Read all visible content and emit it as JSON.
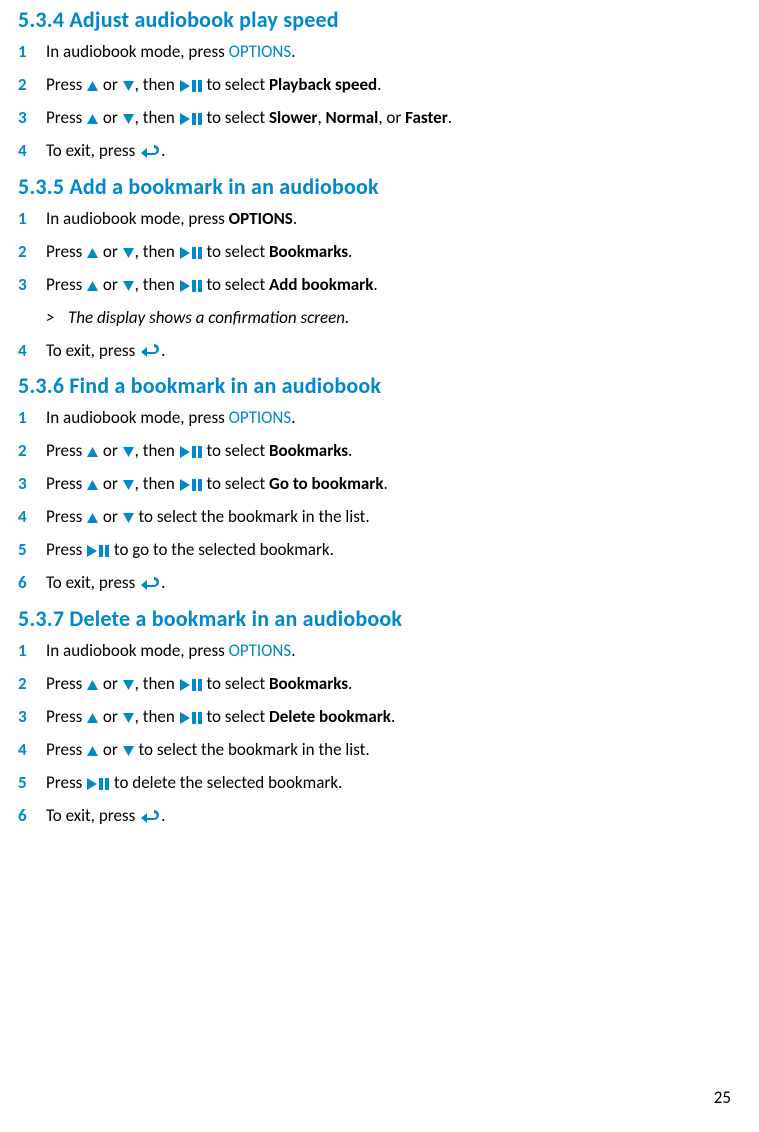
{
  "pageNumber": "25",
  "sections": [
    {
      "heading": "5.3.4 Adjust audiobook play speed",
      "steps": [
        {
          "num": "1",
          "parts": [
            {
              "t": "In audiobook mode, press "
            },
            {
              "t": "OPTIONS",
              "cls": "link-blue"
            },
            {
              "t": "."
            }
          ]
        },
        {
          "num": "2",
          "parts": [
            {
              "t": "Press "
            },
            {
              "icon": "up"
            },
            {
              "t": " or "
            },
            {
              "icon": "down"
            },
            {
              "t": ", then "
            },
            {
              "icon": "playpause"
            },
            {
              "t": " to select "
            },
            {
              "t": "Playback speed",
              "cls": "bold"
            },
            {
              "t": "."
            }
          ]
        },
        {
          "num": "3",
          "parts": [
            {
              "t": "Press "
            },
            {
              "icon": "up"
            },
            {
              "t": " or "
            },
            {
              "icon": "down"
            },
            {
              "t": ", then "
            },
            {
              "icon": "playpause"
            },
            {
              "t": " to select "
            },
            {
              "t": "Slower",
              "cls": "bold"
            },
            {
              "t": ", "
            },
            {
              "t": "Normal",
              "cls": "bold"
            },
            {
              "t": ", or "
            },
            {
              "t": "Faster",
              "cls": "bold"
            },
            {
              "t": "."
            }
          ]
        },
        {
          "num": "4",
          "parts": [
            {
              "t": "To exit, press "
            },
            {
              "icon": "back"
            },
            {
              "t": "."
            }
          ]
        }
      ]
    },
    {
      "heading": "5.3.5 Add a bookmark in an audiobook",
      "steps": [
        {
          "num": "1",
          "parts": [
            {
              "t": "In audiobook mode, press "
            },
            {
              "t": "OPTIONS",
              "cls": "bold"
            },
            {
              "t": "."
            }
          ]
        },
        {
          "num": "2",
          "parts": [
            {
              "t": "Press "
            },
            {
              "icon": "up"
            },
            {
              "t": " or "
            },
            {
              "icon": "down"
            },
            {
              "t": ", then "
            },
            {
              "icon": "playpause"
            },
            {
              "t": " to select "
            },
            {
              "t": "Bookmarks",
              "cls": "bold"
            },
            {
              "t": "."
            }
          ]
        },
        {
          "num": "3",
          "parts": [
            {
              "t": "Press "
            },
            {
              "icon": "up"
            },
            {
              "t": " or "
            },
            {
              "icon": "down"
            },
            {
              "t": ", then "
            },
            {
              "icon": "playpause"
            },
            {
              "t": " to select "
            },
            {
              "t": "Add bookmark",
              "cls": "bold"
            },
            {
              "t": "."
            }
          ]
        },
        {
          "sub": true,
          "marker": ">",
          "parts": [
            {
              "t": "The display shows a confirmation screen."
            }
          ]
        },
        {
          "num": "4",
          "parts": [
            {
              "t": "To exit, press "
            },
            {
              "icon": "back"
            },
            {
              "t": "."
            }
          ]
        }
      ]
    },
    {
      "heading": "5.3.6 Find a bookmark in an audiobook",
      "steps": [
        {
          "num": "1",
          "parts": [
            {
              "t": "In audiobook mode, press "
            },
            {
              "t": "OPTIONS",
              "cls": "link-blue"
            },
            {
              "t": "."
            }
          ]
        },
        {
          "num": "2",
          "parts": [
            {
              "t": "Press "
            },
            {
              "icon": "up"
            },
            {
              "t": " or "
            },
            {
              "icon": "down"
            },
            {
              "t": ", then "
            },
            {
              "icon": "playpause"
            },
            {
              "t": " to select "
            },
            {
              "t": "Bookmarks",
              "cls": "bold"
            },
            {
              "t": "."
            }
          ]
        },
        {
          "num": "3",
          "parts": [
            {
              "t": "Press "
            },
            {
              "icon": "up"
            },
            {
              "t": " or "
            },
            {
              "icon": "down"
            },
            {
              "t": ", then "
            },
            {
              "icon": "playpause"
            },
            {
              "t": " to select "
            },
            {
              "t": "Go to bookmark",
              "cls": "bold"
            },
            {
              "t": "."
            }
          ]
        },
        {
          "num": "4",
          "parts": [
            {
              "t": "Press "
            },
            {
              "icon": "up"
            },
            {
              "t": " or "
            },
            {
              "icon": "down"
            },
            {
              "t": " to select the bookmark in the list."
            }
          ]
        },
        {
          "num": "5",
          "parts": [
            {
              "t": "Press "
            },
            {
              "icon": "playpause"
            },
            {
              "t": " to go to the selected bookmark."
            }
          ]
        },
        {
          "num": "6",
          "parts": [
            {
              "t": "To exit, press "
            },
            {
              "icon": "back"
            },
            {
              "t": "."
            }
          ]
        }
      ]
    },
    {
      "heading": "5.3.7 Delete a bookmark in an audiobook",
      "steps": [
        {
          "num": "1",
          "parts": [
            {
              "t": "In audiobook mode, press "
            },
            {
              "t": "OPTIONS",
              "cls": "link-blue"
            },
            {
              "t": "."
            }
          ]
        },
        {
          "num": "2",
          "parts": [
            {
              "t": "Press "
            },
            {
              "icon": "up"
            },
            {
              "t": " or "
            },
            {
              "icon": "down"
            },
            {
              "t": ", then "
            },
            {
              "icon": "playpause"
            },
            {
              "t": " to select "
            },
            {
              "t": "Bookmarks",
              "cls": "bold"
            },
            {
              "t": "."
            }
          ]
        },
        {
          "num": "3",
          "parts": [
            {
              "t": "Press "
            },
            {
              "icon": "up"
            },
            {
              "t": " or "
            },
            {
              "icon": "down"
            },
            {
              "t": ", then "
            },
            {
              "icon": "playpause"
            },
            {
              "t": " to select "
            },
            {
              "t": "Delete bookmark",
              "cls": "bold"
            },
            {
              "t": "."
            }
          ]
        },
        {
          "num": "4",
          "parts": [
            {
              "t": "Press "
            },
            {
              "icon": "up"
            },
            {
              "t": " or "
            },
            {
              "icon": "down"
            },
            {
              "t": " to select the bookmark in the list."
            }
          ]
        },
        {
          "num": "5",
          "parts": [
            {
              "t": "Press "
            },
            {
              "icon": "playpause"
            },
            {
              "t": " to delete the selected bookmark."
            }
          ]
        },
        {
          "num": "6",
          "parts": [
            {
              "t": "To exit, press "
            },
            {
              "icon": "back"
            },
            {
              "t": "."
            }
          ]
        }
      ]
    }
  ]
}
